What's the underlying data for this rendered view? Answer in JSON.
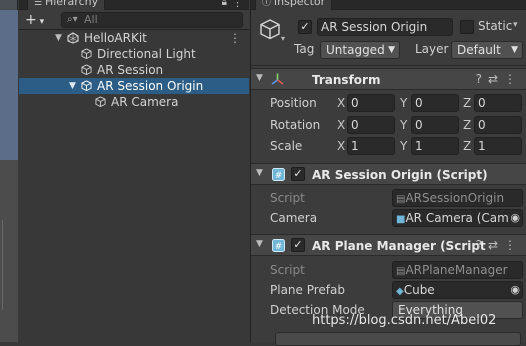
{
  "hierarchy": {
    "tab_label": "Hierarchy",
    "search_placeholder": "All",
    "scene_name": "HelloARKit",
    "items": [
      {
        "label": "Directional Light"
      },
      {
        "label": "AR Session"
      },
      {
        "label": "AR Session Origin"
      },
      {
        "label": "AR Camera"
      }
    ]
  },
  "inspector": {
    "tab_label": "Inspector",
    "object_name": "AR Session Origin",
    "static_label": "Static",
    "tag_label": "Tag",
    "tag_value": "Untagged",
    "layer_label": "Layer",
    "layer_value": "Default",
    "transform": {
      "title": "Transform",
      "rows": [
        {
          "label": "Position",
          "x": "0",
          "y": "0",
          "z": "0"
        },
        {
          "label": "Rotation",
          "x": "0",
          "y": "0",
          "z": "0"
        },
        {
          "label": "Scale",
          "x": "1",
          "y": "1",
          "z": "1"
        }
      ]
    },
    "origin_script": {
      "title": "AR Session Origin (Script)",
      "script_label": "Script",
      "script_value": "ARSessionOrigin",
      "camera_label": "Camera",
      "camera_value": "AR Camera (Cam"
    },
    "plane_manager": {
      "title": "AR Plane Manager (Script",
      "script_label": "Script",
      "script_value": "ARPlaneManager",
      "prefab_label": "Plane Prefab",
      "prefab_value": "Cube",
      "detection_label": "Detection Mode",
      "detection_value": "Everything"
    }
  },
  "watermark": "https://blog.csdn.net/Abel02",
  "colors": {
    "selection": "#2c5d87",
    "panel": "#383838"
  }
}
